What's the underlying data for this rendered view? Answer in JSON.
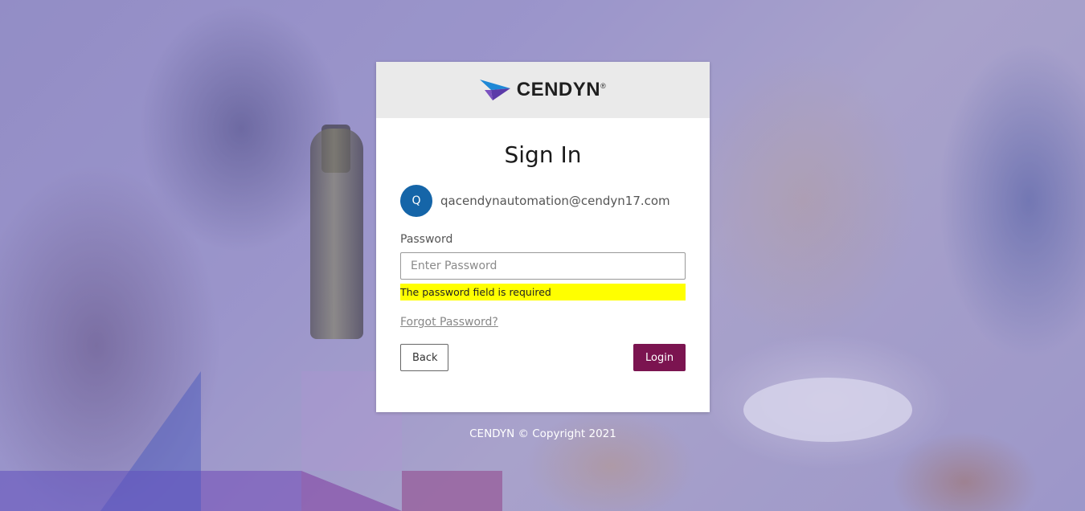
{
  "brand": {
    "name": "CENDYN",
    "registered_mark": "®",
    "colors": {
      "accent": "#7b1450",
      "avatar": "#1565a8",
      "error_highlight": "#ffff00"
    }
  },
  "signin": {
    "title": "Sign In",
    "user": {
      "initial": "Q",
      "email": "qacendynautomation@cendyn17.com"
    },
    "password": {
      "label": "Password",
      "value": "",
      "placeholder": "Enter Password",
      "error": "The password field is required"
    },
    "forgot_link": "Forgot Password?",
    "back_button": "Back",
    "login_button": "Login"
  },
  "footer": {
    "copyright": "CENDYN © Copyright 2021"
  }
}
